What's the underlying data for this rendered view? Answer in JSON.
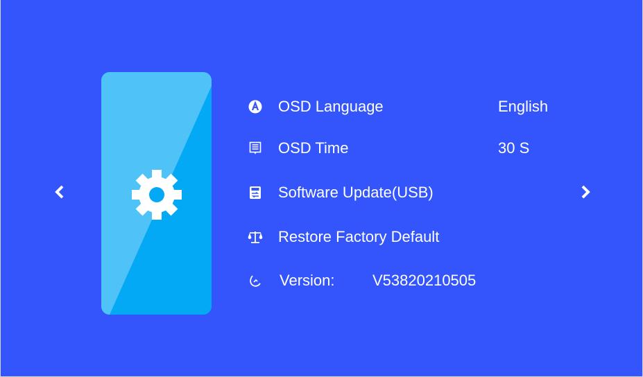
{
  "navigation": {
    "prev_icon": "chevron-left-icon",
    "next_icon": "chevron-right-icon"
  },
  "card": {
    "icon": "gear-icon",
    "colors": {
      "light": "#4fc3f7",
      "dark": "#03a9f4"
    }
  },
  "menu": {
    "items": [
      {
        "icon": "language-a-icon",
        "label": "OSD Language",
        "value": "English"
      },
      {
        "icon": "document-icon",
        "label": "OSD Time",
        "value": "30 S"
      },
      {
        "icon": "usb-update-icon",
        "label": "Software Update(USB)",
        "value": ""
      },
      {
        "icon": "scale-restore-icon",
        "label": "Restore Factory Default",
        "value": ""
      },
      {
        "icon": "version-hook-icon",
        "label": "Version:",
        "value": "V53820210505"
      }
    ]
  },
  "colors": {
    "background": "#3355fb",
    "text": "#ffffff"
  }
}
